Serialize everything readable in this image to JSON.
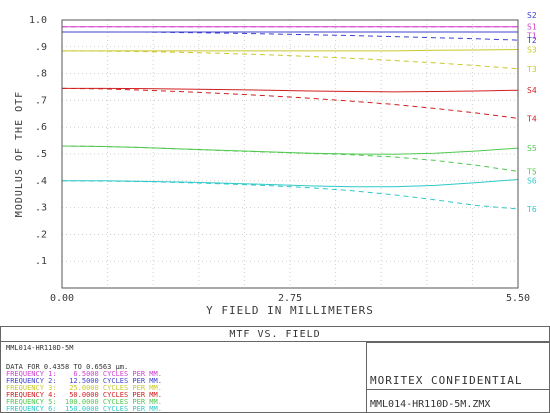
{
  "chart_data": {
    "type": "line",
    "title": "MTF VS. FIELD",
    "xlabel": "Y FIELD IN MILLIMETERS",
    "ylabel": "MODULUS OF THE OTF",
    "xlim": [
      0,
      5.5
    ],
    "ylim": [
      0,
      1.0
    ],
    "x_ticks": [
      "0.00",
      "2.75",
      "5.50"
    ],
    "y_ticks": [
      ".1",
      ".2",
      ".3",
      ".4",
      ".5",
      ".6",
      ".7",
      ".8",
      ".9",
      "1.0"
    ],
    "grid": true,
    "x": [
      0,
      0.5,
      1,
      1.5,
      2,
      2.5,
      3,
      3.5,
      4,
      4.5,
      5,
      5.5
    ],
    "series": [
      {
        "name": "S2",
        "color": "#4040d0",
        "dash": false,
        "values": [
          0.955,
          0.955,
          0.955,
          0.955,
          0.955,
          0.955,
          0.955,
          0.955,
          0.955,
          0.955,
          0.955,
          0.955
        ]
      },
      {
        "name": "S1",
        "color": "#d040d0",
        "dash": false,
        "values": [
          0.975,
          0.975,
          0.975,
          0.975,
          0.975,
          0.975,
          0.975,
          0.975,
          0.975,
          0.975,
          0.975,
          0.975
        ]
      },
      {
        "name": "T1",
        "color": "#d040d0",
        "dash": true,
        "values": [
          0.975,
          0.975,
          0.975,
          0.975,
          0.975,
          0.975,
          0.975,
          0.975,
          0.975,
          0.975,
          0.975,
          0.975
        ]
      },
      {
        "name": "T2",
        "color": "#4040d0",
        "dash": true,
        "values": [
          0.955,
          0.955,
          0.955,
          0.953,
          0.951,
          0.948,
          0.945,
          0.942,
          0.938,
          0.934,
          0.93,
          0.925
        ]
      },
      {
        "name": "S3",
        "color": "#c8c830",
        "dash": false,
        "values": [
          0.885,
          0.885,
          0.885,
          0.885,
          0.885,
          0.885,
          0.885,
          0.885,
          0.885,
          0.887,
          0.888,
          0.89
        ]
      },
      {
        "name": "T3",
        "color": "#c8c830",
        "dash": true,
        "values": [
          0.885,
          0.884,
          0.882,
          0.879,
          0.875,
          0.87,
          0.864,
          0.857,
          0.849,
          0.84,
          0.83,
          0.818
        ]
      },
      {
        "name": "S4",
        "color": "#d02020",
        "dash": false,
        "values": [
          0.745,
          0.745,
          0.744,
          0.742,
          0.74,
          0.738,
          0.735,
          0.733,
          0.732,
          0.733,
          0.735,
          0.738
        ]
      },
      {
        "name": "T4",
        "color": "#d02020",
        "dash": true,
        "values": [
          0.745,
          0.743,
          0.738,
          0.732,
          0.725,
          0.717,
          0.708,
          0.697,
          0.685,
          0.67,
          0.653,
          0.633
        ]
      },
      {
        "name": "S5",
        "color": "#50c850",
        "dash": false,
        "values": [
          0.53,
          0.528,
          0.524,
          0.518,
          0.513,
          0.508,
          0.503,
          0.5,
          0.499,
          0.503,
          0.511,
          0.522
        ]
      },
      {
        "name": "T5",
        "color": "#50c850",
        "dash": true,
        "values": [
          0.53,
          0.528,
          0.524,
          0.518,
          0.512,
          0.507,
          0.502,
          0.497,
          0.489,
          0.476,
          0.458,
          0.435
        ]
      },
      {
        "name": "S6",
        "color": "#30c8c8",
        "dash": false,
        "values": [
          0.4,
          0.4,
          0.398,
          0.395,
          0.391,
          0.386,
          0.381,
          0.378,
          0.378,
          0.383,
          0.393,
          0.405
        ]
      },
      {
        "name": "T6",
        "color": "#30c8c8",
        "dash": true,
        "values": [
          0.4,
          0.399,
          0.397,
          0.393,
          0.388,
          0.382,
          0.374,
          0.363,
          0.348,
          0.329,
          0.308,
          0.295
        ]
      }
    ]
  },
  "footer": {
    "title": "MTF VS. FIELD",
    "lens_name": "MML014-HR110D-5M",
    "data_range": "DATA FOR 0.4358 TO 0.6563 µm.",
    "frequencies": [
      {
        "text": "FREQUENCY 1:    6.5000 CYCLES PER MM.",
        "color": "#d040d0"
      },
      {
        "text": "FREQUENCY 2:   12.5000 CYCLES PER MM.",
        "color": "#4040d0"
      },
      {
        "text": "FREQUENCY 3:   25.0000 CYCLES PER MM.",
        "color": "#c8c830"
      },
      {
        "text": "FREQUENCY 4:   50.0000 CYCLES PER MM.",
        "color": "#d02020"
      },
      {
        "text": "FREQUENCY 5:  100.0000 CYCLES PER MM.",
        "color": "#50c850"
      },
      {
        "text": "FREQUENCY 6:  150.0000 CYCLES PER MM.",
        "color": "#30c8c8"
      }
    ],
    "confidential": "MORITEX CONFIDENTIAL",
    "filename": "MML014-HR110D-5M.ZMX"
  }
}
